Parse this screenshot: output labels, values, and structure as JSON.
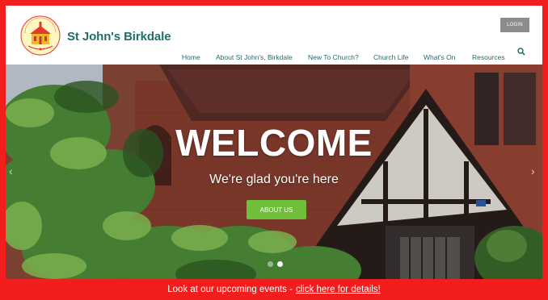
{
  "header": {
    "site_title": "St John's Birkdale",
    "logo_text": "St John's Birkdale",
    "login_label": "LOGIN"
  },
  "nav": {
    "items": [
      {
        "label": "Home"
      },
      {
        "label": "About St John's, Birkdale"
      },
      {
        "label": "New To Church?"
      },
      {
        "label": "Church Life"
      },
      {
        "label": "What's On"
      },
      {
        "label": "Resources"
      }
    ],
    "search_icon": "search-icon"
  },
  "hero": {
    "heading": "WELCOME",
    "tagline": "We're glad you're here",
    "button_label": "ABOUT US",
    "prev_arrow": "‹",
    "next_arrow": "›",
    "active_slide": 2,
    "slide_count": 2
  },
  "banner": {
    "text": "Look at our upcoming events -",
    "link_text": "click here for details!"
  },
  "colors": {
    "frame_red": "#f21d1d",
    "brand_teal": "#1e6f6c",
    "button_green": "#6fbf3a",
    "login_gray": "#8c8c8c"
  }
}
